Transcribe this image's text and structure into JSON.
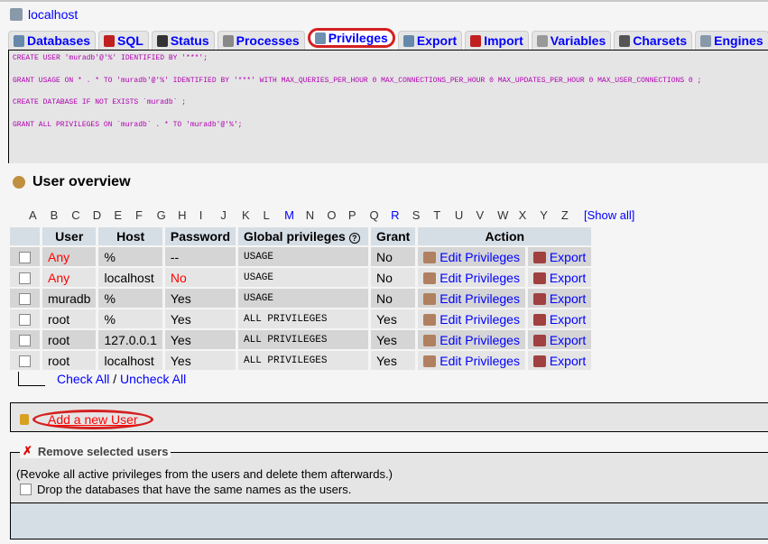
{
  "server": {
    "name": "localhost",
    "icon": "server-icon"
  },
  "tabs": [
    {
      "label": "Databases",
      "icon": "database-icon"
    },
    {
      "label": "SQL",
      "icon": "sql-icon"
    },
    {
      "label": "Status",
      "icon": "traffic-light-icon"
    },
    {
      "label": "Processes",
      "icon": "gears-icon"
    },
    {
      "label": "Privileges",
      "icon": "users-icon",
      "active": true
    },
    {
      "label": "Export",
      "icon": "export-icon"
    },
    {
      "label": "Import",
      "icon": "import-icon"
    },
    {
      "label": "Variables",
      "icon": "variables-icon"
    },
    {
      "label": "Charsets",
      "icon": "charsets-icon"
    },
    {
      "label": "Engines",
      "icon": "engines-icon"
    }
  ],
  "sql": [
    "CREATE USER 'muradb'@'%' IDENTIFIED BY '***';",
    "GRANT USAGE ON * . * TO 'muradb'@'%' IDENTIFIED BY '***' WITH MAX_QUERIES_PER_HOUR 0 MAX_CONNECTIONS_PER_HOUR 0 MAX_UPDATES_PER_HOUR 0 MAX_USER_CONNECTIONS 0 ;",
    "CREATE DATABASE IF NOT EXISTS `muradb` ;",
    "GRANT ALL PRIVILEGES ON `muradb` . * TO 'muradb'@'%';"
  ],
  "overview": {
    "title": "User overview"
  },
  "alphabet": [
    "A",
    "B",
    "C",
    "D",
    "E",
    "F",
    "G",
    "H",
    "I",
    "J",
    "K",
    "L",
    "M",
    "N",
    "O",
    "P",
    "Q",
    "R",
    "S",
    "T",
    "U",
    "V",
    "W",
    "X",
    "Y",
    "Z"
  ],
  "alphabet_links": [
    "M",
    "R"
  ],
  "show_all": "[Show all]",
  "table": {
    "headers": [
      "User",
      "Host",
      "Password",
      "Global privileges",
      "Grant",
      "Action"
    ],
    "edit_label": "Edit Privileges",
    "export_label": "Export",
    "rows": [
      {
        "user": "Any",
        "host": "%",
        "password": "--",
        "priv": "USAGE",
        "grant": "No",
        "user_red": true
      },
      {
        "user": "Any",
        "host": "localhost",
        "password": "No",
        "priv": "USAGE",
        "grant": "No",
        "user_red": true,
        "pw_red": true
      },
      {
        "user": "muradb",
        "host": "%",
        "password": "Yes",
        "priv": "USAGE",
        "grant": "No"
      },
      {
        "user": "root",
        "host": "%",
        "password": "Yes",
        "priv": "ALL PRIVILEGES",
        "grant": "Yes"
      },
      {
        "user": "root",
        "host": "127.0.0.1",
        "password": "Yes",
        "priv": "ALL PRIVILEGES",
        "grant": "Yes"
      },
      {
        "user": "root",
        "host": "localhost",
        "password": "Yes",
        "priv": "ALL PRIVILEGES",
        "grant": "Yes"
      }
    ]
  },
  "check_all": "Check All",
  "separator": "/",
  "uncheck_all": "Uncheck All",
  "add_user": "Add a new User",
  "remove": {
    "legend": "Remove selected users",
    "note": "(Revoke all active privileges from the users and delete them afterwards.)",
    "drop_label": "Drop the databases that have the same names as the users."
  }
}
